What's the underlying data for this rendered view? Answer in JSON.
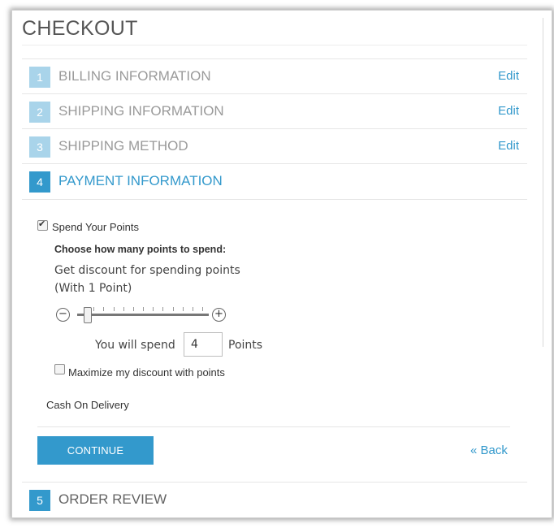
{
  "page": {
    "title": "CHECKOUT"
  },
  "steps": [
    {
      "number": "1",
      "label": "BILLING INFORMATION",
      "edit": "Edit"
    },
    {
      "number": "2",
      "label": "SHIPPING INFORMATION",
      "edit": "Edit"
    },
    {
      "number": "3",
      "label": "SHIPPING METHOD",
      "edit": "Edit"
    },
    {
      "number": "4",
      "label": "PAYMENT INFORMATION"
    },
    {
      "number": "5",
      "label": "ORDER REVIEW"
    }
  ],
  "payment": {
    "spend_points_label": "Spend Your Points",
    "spend_points_checked": true,
    "choose_label": "Choose how many points to spend:",
    "discount_line1": "Get discount for spending points",
    "discount_line2": "(With 1 Point)",
    "slider": {
      "minus": "−",
      "plus": "+",
      "value_fraction": 0.05
    },
    "spend_prefix": "You will spend",
    "spend_value": "4",
    "spend_suffix": "Points",
    "maximize_label": "Maximize my discount with points",
    "maximize_checked": false,
    "method_label": "Cash On Delivery"
  },
  "actions": {
    "continue_label": "CONTINUE",
    "back_label": "« Back"
  },
  "colors": {
    "accent": "#3399cc",
    "step_inactive": "#a9d4ea"
  }
}
